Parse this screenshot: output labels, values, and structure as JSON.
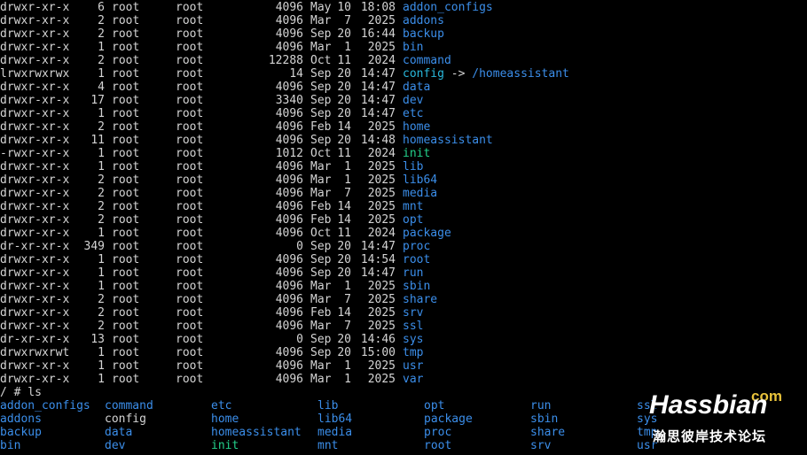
{
  "listing": [
    {
      "perm": "drwxr-xr-x",
      "links": "6",
      "owner": "root",
      "group": "root",
      "size": "4096",
      "month": "May",
      "day": "10",
      "time": "18:08",
      "name": "addon_configs",
      "type": "dir"
    },
    {
      "perm": "drwxr-xr-x",
      "links": "2",
      "owner": "root",
      "group": "root",
      "size": "4096",
      "month": "Mar",
      "day": "7",
      "time": "2025",
      "name": "addons",
      "type": "dir"
    },
    {
      "perm": "drwxr-xr-x",
      "links": "2",
      "owner": "root",
      "group": "root",
      "size": "4096",
      "month": "Sep",
      "day": "20",
      "time": "16:44",
      "name": "backup",
      "type": "dir"
    },
    {
      "perm": "drwxr-xr-x",
      "links": "1",
      "owner": "root",
      "group": "root",
      "size": "4096",
      "month": "Mar",
      "day": "1",
      "time": "2025",
      "name": "bin",
      "type": "dir"
    },
    {
      "perm": "drwxr-xr-x",
      "links": "2",
      "owner": "root",
      "group": "root",
      "size": "12288",
      "month": "Oct",
      "day": "11",
      "time": "2024",
      "name": "command",
      "type": "dir"
    },
    {
      "perm": "lrwxrwxrwx",
      "links": "1",
      "owner": "root",
      "group": "root",
      "size": "14",
      "month": "Sep",
      "day": "20",
      "time": "14:47",
      "name": "config",
      "type": "link",
      "arrow": "->",
      "target": "/homeassistant"
    },
    {
      "perm": "drwxr-xr-x",
      "links": "4",
      "owner": "root",
      "group": "root",
      "size": "4096",
      "month": "Sep",
      "day": "20",
      "time": "14:47",
      "name": "data",
      "type": "dir"
    },
    {
      "perm": "drwxr-xr-x",
      "links": "17",
      "owner": "root",
      "group": "root",
      "size": "3340",
      "month": "Sep",
      "day": "20",
      "time": "14:47",
      "name": "dev",
      "type": "dir"
    },
    {
      "perm": "drwxr-xr-x",
      "links": "1",
      "owner": "root",
      "group": "root",
      "size": "4096",
      "month": "Sep",
      "day": "20",
      "time": "14:47",
      "name": "etc",
      "type": "dir"
    },
    {
      "perm": "drwxr-xr-x",
      "links": "2",
      "owner": "root",
      "group": "root",
      "size": "4096",
      "month": "Feb",
      "day": "14",
      "time": "2025",
      "name": "home",
      "type": "dir"
    },
    {
      "perm": "drwxr-xr-x",
      "links": "11",
      "owner": "root",
      "group": "root",
      "size": "4096",
      "month": "Sep",
      "day": "20",
      "time": "14:48",
      "name": "homeassistant",
      "type": "dir"
    },
    {
      "perm": "-rwxr-xr-x",
      "links": "1",
      "owner": "root",
      "group": "root",
      "size": "1012",
      "month": "Oct",
      "day": "11",
      "time": "2024",
      "name": "init",
      "type": "exe"
    },
    {
      "perm": "drwxr-xr-x",
      "links": "1",
      "owner": "root",
      "group": "root",
      "size": "4096",
      "month": "Mar",
      "day": "1",
      "time": "2025",
      "name": "lib",
      "type": "dir"
    },
    {
      "perm": "drwxr-xr-x",
      "links": "2",
      "owner": "root",
      "group": "root",
      "size": "4096",
      "month": "Mar",
      "day": "1",
      "time": "2025",
      "name": "lib64",
      "type": "dir"
    },
    {
      "perm": "drwxr-xr-x",
      "links": "2",
      "owner": "root",
      "group": "root",
      "size": "4096",
      "month": "Mar",
      "day": "7",
      "time": "2025",
      "name": "media",
      "type": "dir"
    },
    {
      "perm": "drwxr-xr-x",
      "links": "2",
      "owner": "root",
      "group": "root",
      "size": "4096",
      "month": "Feb",
      "day": "14",
      "time": "2025",
      "name": "mnt",
      "type": "dir"
    },
    {
      "perm": "drwxr-xr-x",
      "links": "2",
      "owner": "root",
      "group": "root",
      "size": "4096",
      "month": "Feb",
      "day": "14",
      "time": "2025",
      "name": "opt",
      "type": "dir"
    },
    {
      "perm": "drwxr-xr-x",
      "links": "1",
      "owner": "root",
      "group": "root",
      "size": "4096",
      "month": "Oct",
      "day": "11",
      "time": "2024",
      "name": "package",
      "type": "dir"
    },
    {
      "perm": "dr-xr-xr-x",
      "links": "349",
      "owner": "root",
      "group": "root",
      "size": "0",
      "month": "Sep",
      "day": "20",
      "time": "14:47",
      "name": "proc",
      "type": "dir"
    },
    {
      "perm": "drwxr-xr-x",
      "links": "1",
      "owner": "root",
      "group": "root",
      "size": "4096",
      "month": "Sep",
      "day": "20",
      "time": "14:54",
      "name": "root",
      "type": "dir"
    },
    {
      "perm": "drwxr-xr-x",
      "links": "1",
      "owner": "root",
      "group": "root",
      "size": "4096",
      "month": "Sep",
      "day": "20",
      "time": "14:47",
      "name": "run",
      "type": "dir"
    },
    {
      "perm": "drwxr-xr-x",
      "links": "1",
      "owner": "root",
      "group": "root",
      "size": "4096",
      "month": "Mar",
      "day": "1",
      "time": "2025",
      "name": "sbin",
      "type": "dir"
    },
    {
      "perm": "drwxr-xr-x",
      "links": "2",
      "owner": "root",
      "group": "root",
      "size": "4096",
      "month": "Mar",
      "day": "7",
      "time": "2025",
      "name": "share",
      "type": "dir"
    },
    {
      "perm": "drwxr-xr-x",
      "links": "2",
      "owner": "root",
      "group": "root",
      "size": "4096",
      "month": "Feb",
      "day": "14",
      "time": "2025",
      "name": "srv",
      "type": "dir"
    },
    {
      "perm": "drwxr-xr-x",
      "links": "2",
      "owner": "root",
      "group": "root",
      "size": "4096",
      "month": "Mar",
      "day": "7",
      "time": "2025",
      "name": "ssl",
      "type": "dir"
    },
    {
      "perm": "dr-xr-xr-x",
      "links": "13",
      "owner": "root",
      "group": "root",
      "size": "0",
      "month": "Sep",
      "day": "20",
      "time": "14:46",
      "name": "sys",
      "type": "dir"
    },
    {
      "perm": "drwxrwxrwt",
      "links": "1",
      "owner": "root",
      "group": "root",
      "size": "4096",
      "month": "Sep",
      "day": "20",
      "time": "15:00",
      "name": "tmp",
      "type": "dir"
    },
    {
      "perm": "drwxr-xr-x",
      "links": "1",
      "owner": "root",
      "group": "root",
      "size": "4096",
      "month": "Mar",
      "day": "1",
      "time": "2025",
      "name": "usr",
      "type": "dir"
    },
    {
      "perm": "drwxr-xr-x",
      "links": "1",
      "owner": "root",
      "group": "root",
      "size": "4096",
      "month": "Mar",
      "day": "1",
      "time": "2025",
      "name": "var",
      "type": "dir"
    }
  ],
  "prompt": "/ # ls",
  "ls_grid": [
    [
      {
        "name": "addon_configs",
        "type": "dir"
      },
      {
        "name": "command",
        "type": "dir"
      },
      {
        "name": "etc",
        "type": "dir"
      },
      {
        "name": "lib",
        "type": "dir"
      },
      {
        "name": "opt",
        "type": "dir"
      },
      {
        "name": "run",
        "type": "dir"
      },
      {
        "name": "ssl",
        "type": "dir"
      }
    ],
    [
      {
        "name": "addons",
        "type": "dir"
      },
      {
        "name": "config",
        "type": "plain"
      },
      {
        "name": "home",
        "type": "dir"
      },
      {
        "name": "lib64",
        "type": "dir"
      },
      {
        "name": "package",
        "type": "dir"
      },
      {
        "name": "sbin",
        "type": "dir"
      },
      {
        "name": "sys",
        "type": "dir"
      }
    ],
    [
      {
        "name": "backup",
        "type": "dir"
      },
      {
        "name": "data",
        "type": "dir"
      },
      {
        "name": "homeassistant",
        "type": "dir"
      },
      {
        "name": "media",
        "type": "dir"
      },
      {
        "name": "proc",
        "type": "dir"
      },
      {
        "name": "share",
        "type": "dir"
      },
      {
        "name": "tmp",
        "type": "dir"
      }
    ],
    [
      {
        "name": "bin",
        "type": "dir"
      },
      {
        "name": "dev",
        "type": "dir"
      },
      {
        "name": "init",
        "type": "exe"
      },
      {
        "name": "mnt",
        "type": "dir"
      },
      {
        "name": "root",
        "type": "dir"
      },
      {
        "name": "srv",
        "type": "dir"
      },
      {
        "name": "usr",
        "type": "dir"
      }
    ]
  ],
  "watermark": {
    "brand": "Hassbian",
    "suffix": "com",
    "subtitle": "瀚思彼岸技术论坛"
  },
  "colors": {
    "background": "#000000",
    "text": "#d4d4d4",
    "directory": "#3b8eea",
    "executable": "#23d18b",
    "symlink": "#29b8db",
    "watermark_accent": "#e8c23a"
  }
}
